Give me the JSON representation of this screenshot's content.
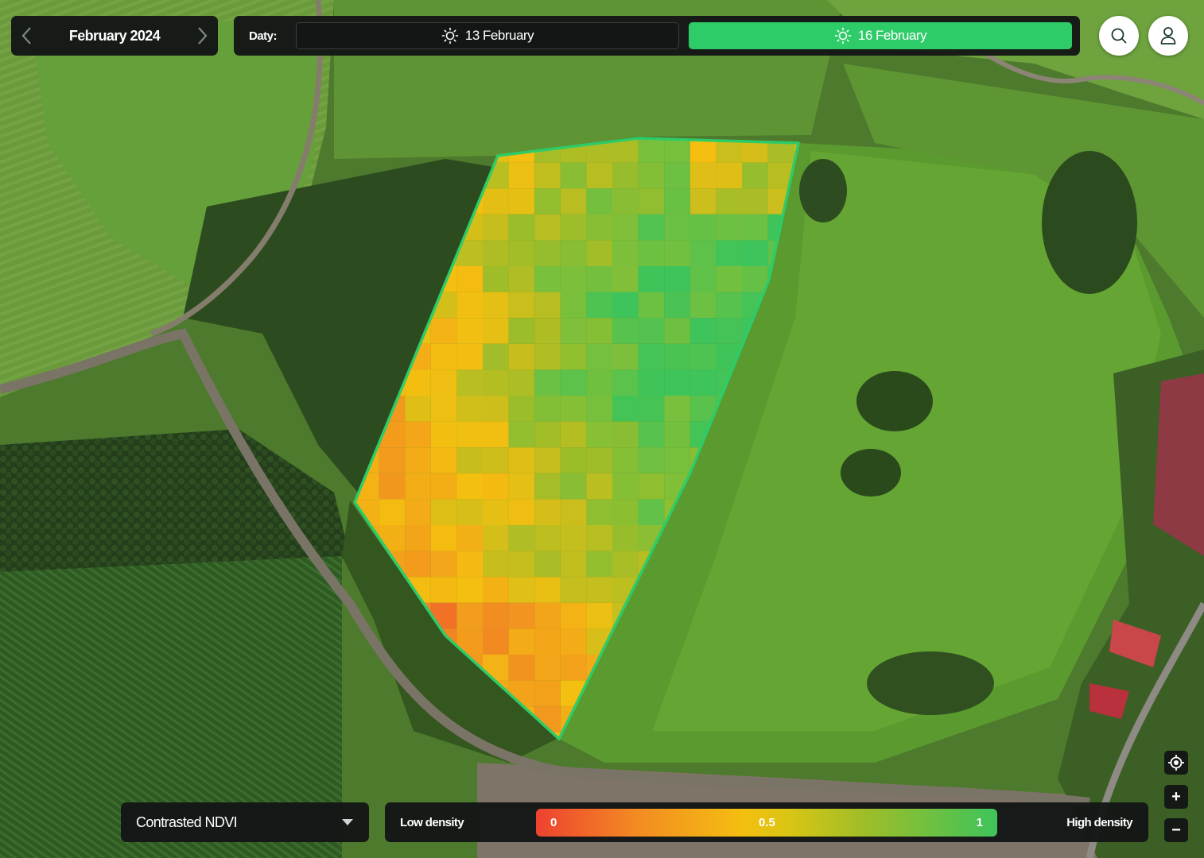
{
  "month_nav": {
    "month_label": "February 2024",
    "prev_icon": "chevron-left-icon",
    "next_icon": "chevron-right-icon"
  },
  "dates": {
    "label": "Daty:",
    "items": [
      {
        "label": "13 February",
        "icon": "sun-icon",
        "selected": false
      },
      {
        "label": "16 February",
        "icon": "sun-icon",
        "selected": true
      }
    ]
  },
  "header_buttons": {
    "search_icon": "search-icon",
    "account_icon": "user-icon"
  },
  "layer_select": {
    "value": "Contrasted NDVI",
    "icon": "caret-down-icon"
  },
  "legend": {
    "low_label": "Low density",
    "high_label": "High density",
    "min": "0",
    "mid": "0.5",
    "max": "1",
    "colors": [
      "#ee4230",
      "#f28c22",
      "#f4bf10",
      "#9cbd2a",
      "#3ec45a"
    ]
  },
  "map_controls": {
    "locate_icon": "crosshair-icon",
    "zoom_in": "+",
    "zoom_out": "−"
  },
  "field": {
    "outline_color": "#2ecc68"
  }
}
